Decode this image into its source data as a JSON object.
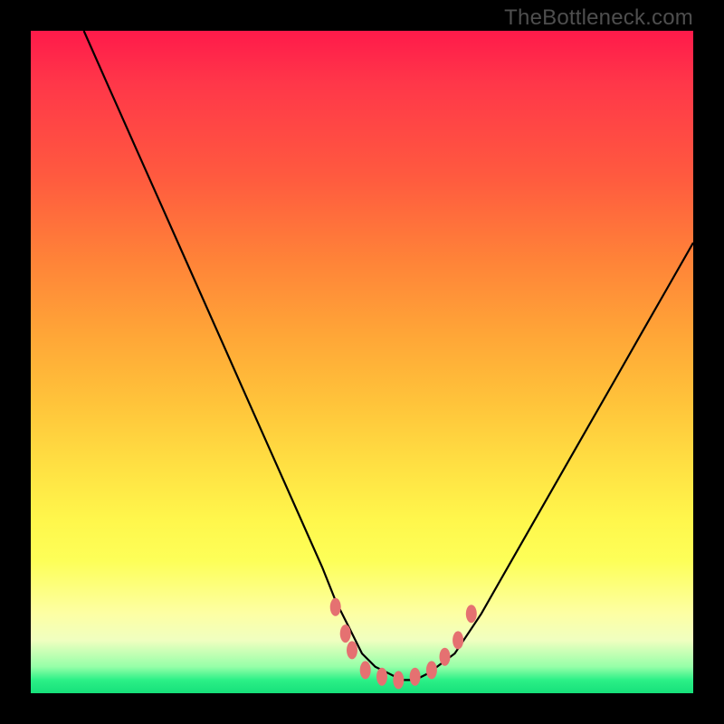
{
  "watermark": "TheBottleneck.com",
  "chart_data": {
    "type": "line",
    "title": "",
    "xlabel": "",
    "ylabel": "",
    "xlim": [
      0,
      100
    ],
    "ylim": [
      0,
      100
    ],
    "grid": false,
    "series": [
      {
        "name": "curve",
        "x": [
          8,
          12,
          16,
          20,
          24,
          28,
          32,
          36,
          40,
          44,
          46,
          48,
          50,
          52,
          54,
          56,
          58,
          60,
          64,
          68,
          72,
          76,
          80,
          84,
          88,
          92,
          96,
          100
        ],
        "values": [
          100,
          91,
          82,
          73,
          64,
          55,
          46,
          37,
          28,
          19,
          14,
          10,
          6,
          4,
          3,
          2,
          2,
          3,
          6,
          12,
          19,
          26,
          33,
          40,
          47,
          54,
          61,
          68
        ]
      }
    ],
    "markers": [
      {
        "x": 46.0,
        "y": 13.0
      },
      {
        "x": 47.5,
        "y": 9.0
      },
      {
        "x": 48.5,
        "y": 6.5
      },
      {
        "x": 50.5,
        "y": 3.5
      },
      {
        "x": 53.0,
        "y": 2.5
      },
      {
        "x": 55.5,
        "y": 2.0
      },
      {
        "x": 58.0,
        "y": 2.5
      },
      {
        "x": 60.5,
        "y": 3.5
      },
      {
        "x": 62.5,
        "y": 5.5
      },
      {
        "x": 64.5,
        "y": 8.0
      },
      {
        "x": 66.5,
        "y": 12.0
      }
    ],
    "marker_style": {
      "fill": "#e57171",
      "rx": 6,
      "ry": 10
    },
    "curve_style": {
      "stroke": "#000000",
      "width": 2.2
    }
  }
}
